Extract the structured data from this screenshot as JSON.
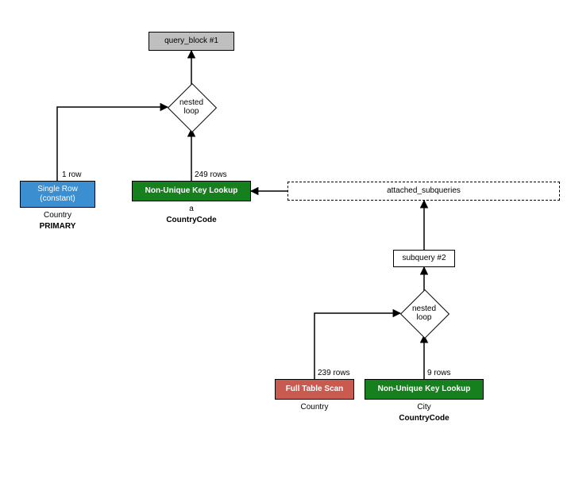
{
  "colors": {
    "blue": "#3b8fd0",
    "green": "#167f1e",
    "red": "#c85a50",
    "gray": "#bfbfbf",
    "white": "#ffffff"
  },
  "nodes": {
    "query_block": {
      "label": "query_block #1"
    },
    "nested_loop_top": {
      "line1": "nested",
      "line2": "loop"
    },
    "single_row": {
      "line1": "Single Row",
      "line2": "(constant)",
      "below1": "Country",
      "below2": "PRIMARY",
      "edge_label": "1 row"
    },
    "nukl_top": {
      "label": "Non-Unique Key Lookup",
      "below1": "a",
      "below2": "CountryCode",
      "edge_label": "249 rows"
    },
    "attached": {
      "label": "attached_subqueries"
    },
    "subquery": {
      "label": "subquery #2"
    },
    "nested_loop_bot": {
      "line1": "nested",
      "line2": "loop"
    },
    "full_scan": {
      "label": "Full Table Scan",
      "below1": "Country",
      "edge_label": "239 rows"
    },
    "nukl_bot": {
      "label": "Non-Unique Key Lookup",
      "below1": "City",
      "below2": "CountryCode",
      "edge_label": "9 rows"
    }
  }
}
